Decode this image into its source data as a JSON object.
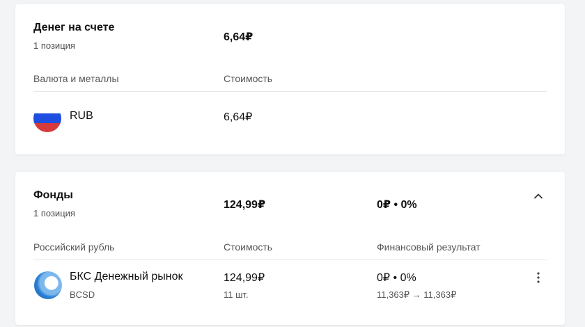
{
  "cash": {
    "title": "Денег на счете",
    "positions": "1 позиция",
    "total": "6,64₽",
    "col_category": "Валюта и металлы",
    "col_value": "Стоимость",
    "items": [
      {
        "name": "RUB",
        "value": "6,64₽",
        "icon": "russia-flag-icon"
      }
    ]
  },
  "funds": {
    "title": "Фонды",
    "positions": "1 позиция",
    "total": "124,99₽",
    "result": "0₽ • 0%",
    "col_category": "Российский рубль",
    "col_value": "Стоимость",
    "col_result": "Финансовый результат",
    "collapse_icon": "chevron-up-icon",
    "items": [
      {
        "name": "БКС Денежный рынок",
        "ticker": "BCSD",
        "value": "124,99₽",
        "quantity": "11 шт.",
        "result": "0₽ • 0%",
        "price_change": "11,363₽ → 11,363₽",
        "icon": "bcs-fund-logo-icon",
        "menu_icon": "more-vertical-icon"
      }
    ]
  },
  "colors": {
    "background": "#f3f4f6",
    "card": "#ffffff",
    "text_primary": "#111111",
    "text_secondary": "#555555",
    "divider": "#e6e7ea",
    "flag_white": "#ffffff",
    "flag_blue": "#1f4fe0",
    "flag_red": "#d63a3a"
  }
}
